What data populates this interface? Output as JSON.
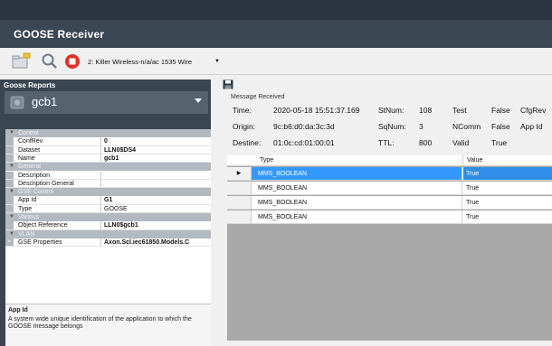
{
  "window": {
    "title": "GOOSE Receiver"
  },
  "toolbar": {
    "interface_select": "2: Killer Wireless-n/a/ac 1535 Wire"
  },
  "left_panel": {
    "heading": "Goose Reports",
    "selected_report": "gcb1",
    "property_grid": {
      "categories": {
        "control": "Control",
        "general": "General",
        "gse_control": "GSE Control",
        "various": "Various",
        "vlan": "VLAN"
      },
      "items": {
        "confrev": {
          "key": "ConfRev",
          "value": "0"
        },
        "dataset": {
          "key": "Dataset",
          "value": "LLN0$DS4"
        },
        "name": {
          "key": "Name",
          "value": "gcb1"
        },
        "description": {
          "key": "Description",
          "value": ""
        },
        "description_general": {
          "key": "Description General",
          "value": ""
        },
        "app_id": {
          "key": "App Id",
          "value": "G1"
        },
        "type": {
          "key": "Type",
          "value": "GOOSE"
        },
        "object_reference": {
          "key": "Object Reference",
          "value": "LLN0$gcb1"
        },
        "gse_properties": {
          "key": "GSE Properties",
          "value": "Axon.Scl.iec61850.Models.C"
        }
      }
    },
    "help": {
      "title": "App Id",
      "text": "A system wide unique identification of the application to which the GOOSE message belongs"
    }
  },
  "message": {
    "legend": "Message Received",
    "time_label": "Time:",
    "time_value": "2020-05-18 15:51:37.169",
    "origin_label": "Origin:",
    "origin_value": "9c:b6:d0:da:3c:3d",
    "destine_label": "Destine:",
    "destine_value": "01:0c:cd:01:00:01",
    "stnum_label": "StNum:",
    "stnum_value": "108",
    "sqnum_label": "SqNum:",
    "sqnum_value": "3",
    "ttl_label": "TTL:",
    "ttl_value": "800",
    "test_label": "Test",
    "test_value": "False",
    "ncomm_label": "NComm",
    "ncomm_value": "False",
    "valid_label": "Valid",
    "valid_value": "True",
    "cfgrev_label": "CfgRev",
    "appid_label": "App Id"
  },
  "grid": {
    "columns": {
      "type": "Type",
      "value": "Value"
    },
    "rows": [
      {
        "type": "MMS_BOOLEAN",
        "value": "True"
      },
      {
        "type": "MMS_BOOLEAN",
        "value": "True"
      },
      {
        "type": "MMS_BOOLEAN",
        "value": "True"
      },
      {
        "type": "MMS_BOOLEAN",
        "value": "True"
      }
    ]
  },
  "icons": {
    "open": "folder-open-icon",
    "search": "search-icon",
    "stop": "stop-icon",
    "save": "floppy-disk-icon",
    "report": "network-icon"
  },
  "colors": {
    "selection": "#3399ff",
    "title_bar": "#3c4754",
    "left_panel": "#3a4652",
    "stop": "#e0302a"
  }
}
